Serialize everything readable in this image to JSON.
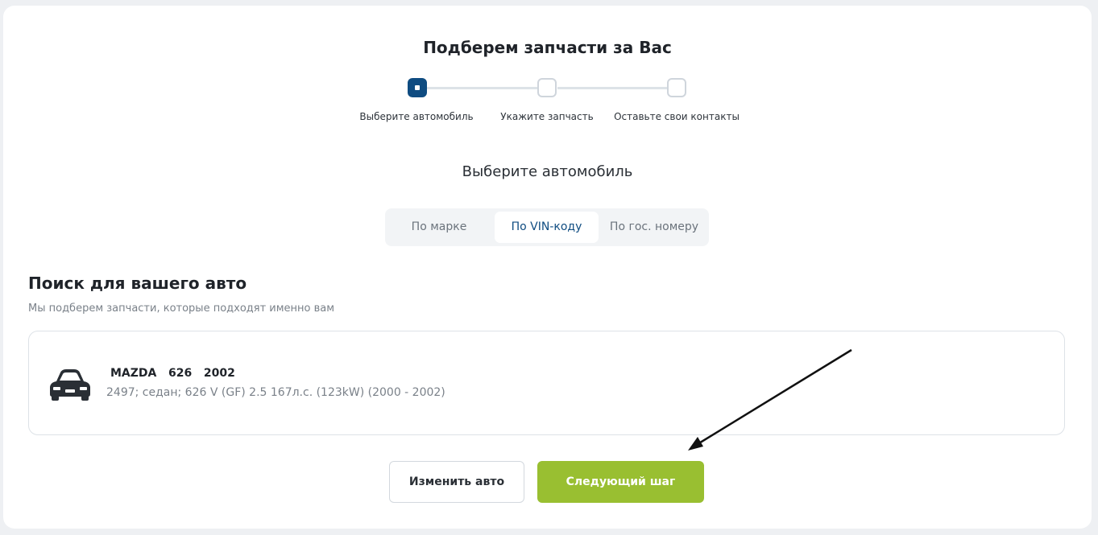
{
  "header": {
    "title": "Подберем запчасти за Вас"
  },
  "steps": [
    {
      "label": "Выберите автомобиль",
      "active": true
    },
    {
      "label": "Укажите запчасть",
      "active": false
    },
    {
      "label": "Оставьте свои контакты",
      "active": false
    }
  ],
  "section": {
    "title": "Выберите автомобиль"
  },
  "tabs": [
    {
      "label": "По марке"
    },
    {
      "label": "По VIN-коду",
      "active": true
    },
    {
      "label": "По гос. номеру"
    }
  ],
  "search": {
    "title": "Поиск для вашего авто",
    "subtitle": "Мы подберем запчасти, которые подходят именно вам"
  },
  "car": {
    "icon": "car-icon",
    "name": "MAZDA   626   2002",
    "description": "2497; седан; 626 V (GF) 2.5 167л.с. (123kW) (2000 - 2002)"
  },
  "buttons": {
    "change_label": "Изменить авто",
    "next_label": "Следующий шаг"
  },
  "colors": {
    "accent": "#0f4c81",
    "primary_button": "#99bf31",
    "background": "#eef0f3"
  }
}
